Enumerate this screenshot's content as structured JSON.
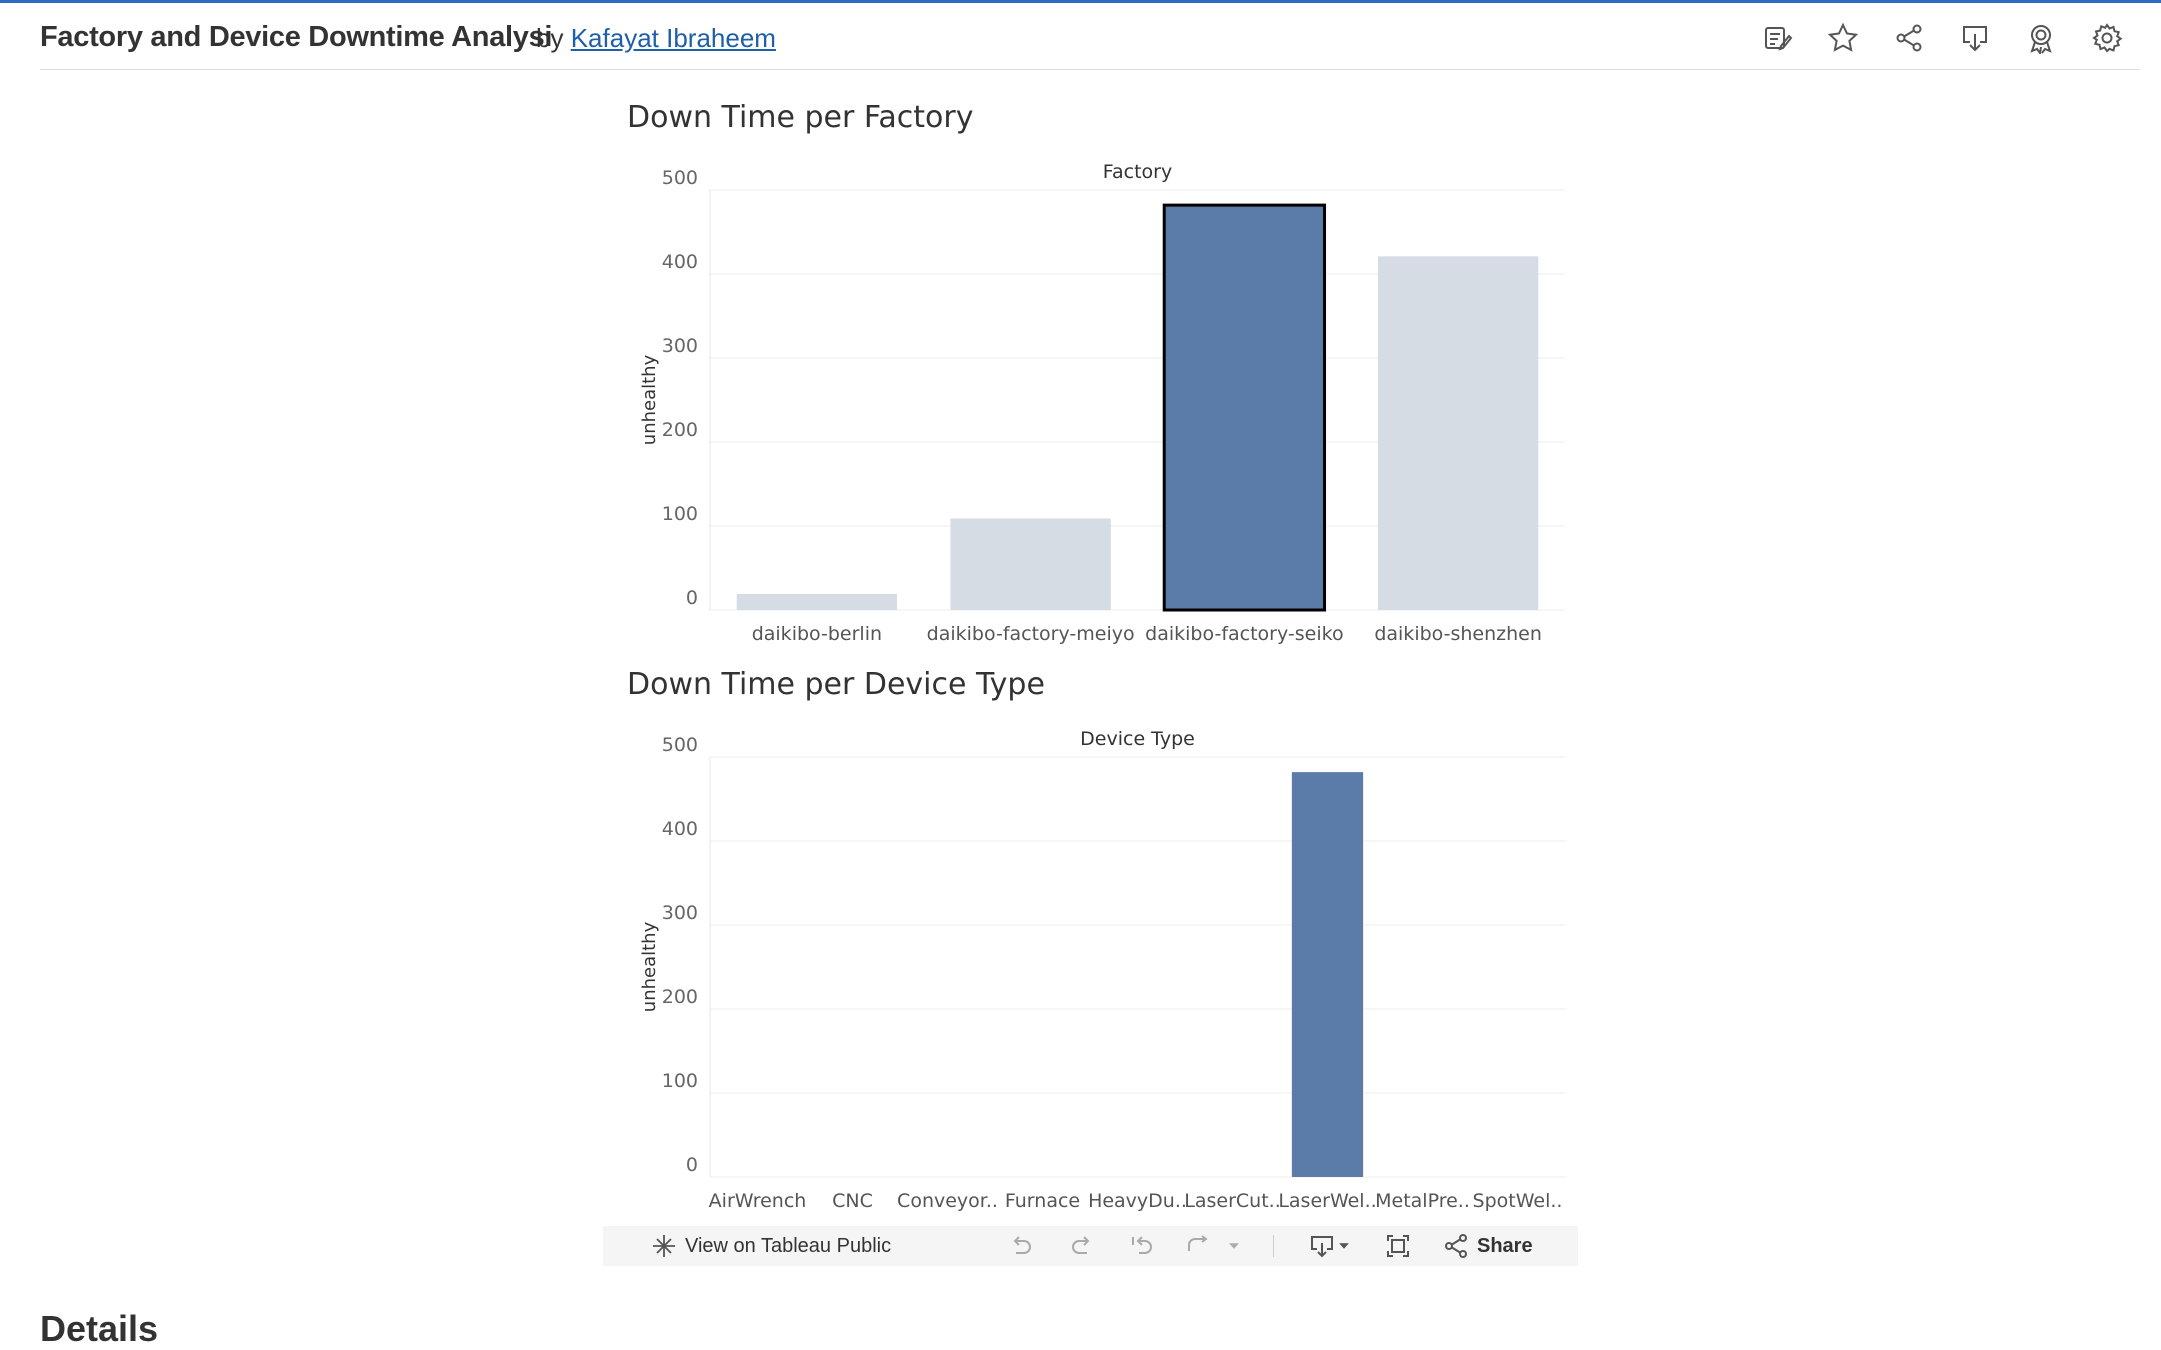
{
  "header": {
    "title": "Factory and Device Downtime Analysi",
    "by": "by",
    "author": "Kafayat Ibraheem",
    "icons": [
      "edit-icon",
      "star-icon",
      "share-icon",
      "download-icon",
      "badge-icon",
      "settings-icon"
    ]
  },
  "colors": {
    "accent": "#2e6bc4",
    "bar_selected": "#5b7ba8",
    "bar_muted": "#d5dce3",
    "link": "#1f5fa8"
  },
  "chart_data": [
    {
      "type": "bar",
      "title": "Down Time per Factory",
      "header": "Factory",
      "ylabel": "unhealthy",
      "ylim": [
        0,
        500
      ],
      "yticks": [
        0,
        100,
        200,
        300,
        400,
        500
      ],
      "categories": [
        "daikibo-berlin",
        "daikibo-factory-meiyo",
        "daikibo-factory-seiko",
        "daikibo-shenzhen"
      ],
      "values": [
        19,
        109,
        482,
        421
      ],
      "selected": "daikibo-factory-seiko"
    },
    {
      "type": "bar",
      "title": "Down Time per Device Type",
      "header": "Device Type",
      "ylabel": "unhealthy",
      "ylim": [
        0,
        500
      ],
      "yticks": [
        0,
        100,
        200,
        300,
        400,
        500
      ],
      "categories": [
        "AirWrench",
        "CNC",
        "Conveyor..",
        "Furnace",
        "HeavyDu..",
        "LaserCut..",
        "LaserWel..",
        "MetalPre..",
        "SpotWel.."
      ],
      "values": [
        0,
        0,
        0,
        0,
        0,
        0,
        482,
        0,
        0
      ]
    }
  ],
  "toolbar": {
    "view_label": "View on Tableau Public",
    "share_label": "Share",
    "icons": [
      "tableau-icon",
      "undo-icon",
      "redo-icon",
      "revert-icon",
      "refresh-icon",
      "dropdown-icon",
      "download-icon",
      "fullscreen-icon",
      "share-icon"
    ]
  },
  "details_heading": "Details"
}
